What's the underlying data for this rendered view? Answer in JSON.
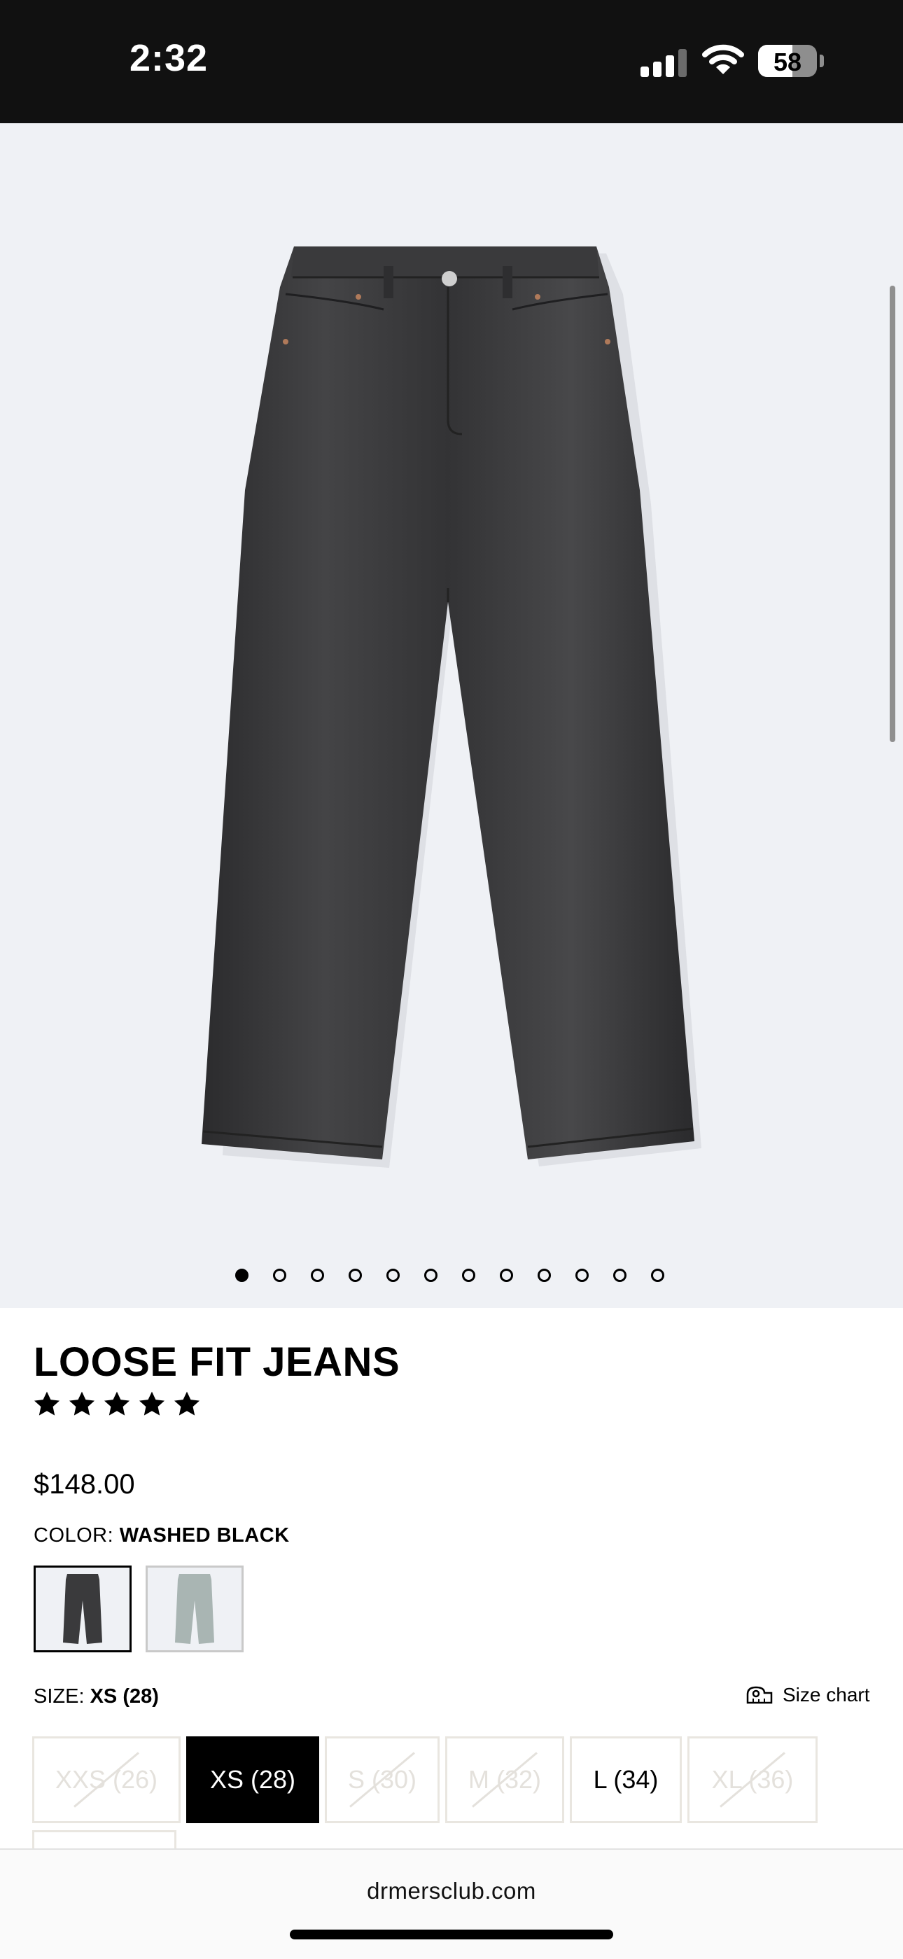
{
  "status_bar": {
    "time": "2:32",
    "battery": "58",
    "battery_level": 0.58,
    "cellular_bars": 3,
    "icons": [
      "cellular-signal-icon",
      "wifi-icon",
      "battery-icon"
    ]
  },
  "gallery": {
    "product_image": "washed-black-jeans-photo",
    "page_count": 12,
    "active_index": 0,
    "background": "#eff1f5"
  },
  "product": {
    "title": "LOOSE FIT JEANS",
    "rating": 5,
    "price": "$148.00"
  },
  "color": {
    "label": "COLOR:",
    "selected": "WASHED BLACK",
    "swatches": [
      {
        "name": "washed-black",
        "color": "#3a3a3c",
        "selected": true
      },
      {
        "name": "light-wash",
        "color": "#a9b5b3",
        "selected": false
      }
    ]
  },
  "size": {
    "label": "SIZE:",
    "selected": "XS (28)",
    "chart_label": "Size chart",
    "options": [
      {
        "label": "XXS (26)",
        "available": false
      },
      {
        "label": "XS (28)",
        "available": true,
        "selected": true
      },
      {
        "label": "S (30)",
        "available": false
      },
      {
        "label": "M (32)",
        "available": false
      },
      {
        "label": "L (34)",
        "available": true
      },
      {
        "label": "XL (36)",
        "available": false
      }
    ]
  },
  "browser": {
    "url": "drmersclub.com"
  }
}
